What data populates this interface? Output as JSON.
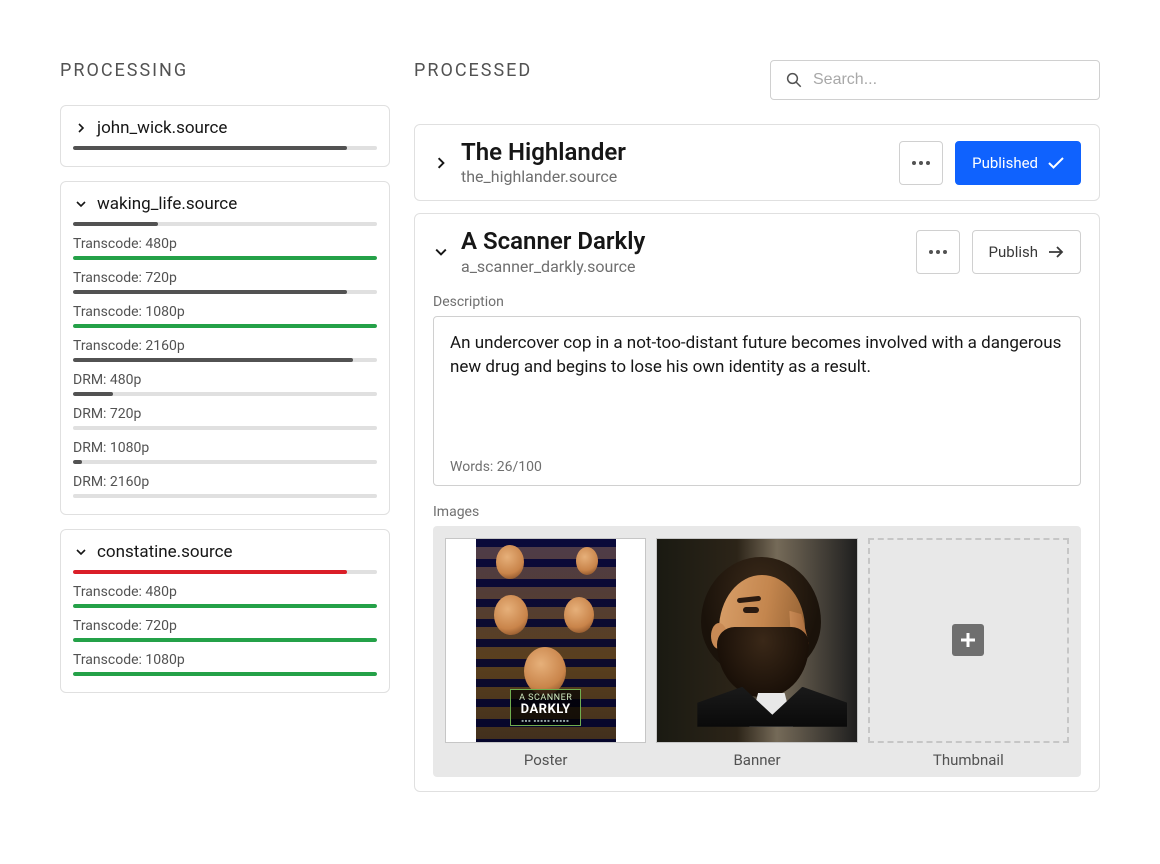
{
  "sections": {
    "processing": "PROCESSING",
    "processed": "PROCESSED"
  },
  "search": {
    "placeholder": "Search..."
  },
  "processing": [
    {
      "title": "john_wick.source",
      "expanded": false,
      "main_progress": 90,
      "main_color": "gray",
      "tasks": []
    },
    {
      "title": "waking_life.source",
      "expanded": true,
      "main_progress": 28,
      "main_color": "gray",
      "tasks": [
        {
          "label": "Transcode: 480p",
          "progress": 100,
          "color": "green"
        },
        {
          "label": "Transcode: 720p",
          "progress": 90,
          "color": "gray"
        },
        {
          "label": "Transcode: 1080p",
          "progress": 100,
          "color": "green"
        },
        {
          "label": "Transcode: 2160p",
          "progress": 92,
          "color": "gray"
        },
        {
          "label": "DRM: 480p",
          "progress": 13,
          "color": "gray"
        },
        {
          "label": "DRM: 720p",
          "progress": 0,
          "color": "gray"
        },
        {
          "label": "DRM: 1080p",
          "progress": 3,
          "color": "gray"
        },
        {
          "label": "DRM: 2160p",
          "progress": 0,
          "color": "gray"
        }
      ]
    },
    {
      "title": "constatine.source",
      "expanded": true,
      "main_progress": 90,
      "main_color": "red",
      "tasks": [
        {
          "label": "Transcode: 480p",
          "progress": 100,
          "color": "green"
        },
        {
          "label": "Transcode: 720p",
          "progress": 100,
          "color": "green"
        },
        {
          "label": "Transcode: 1080p",
          "progress": 100,
          "color": "green"
        }
      ]
    }
  ],
  "processed": [
    {
      "title": "The Highlander",
      "filename": "the_highlander.source",
      "expanded": false,
      "button_label": "Published",
      "button_style": "primary"
    },
    {
      "title": "A Scanner Darkly",
      "filename": "a_scanner_darkly.source",
      "expanded": true,
      "button_label": "Publish",
      "button_style": "outline",
      "description_label": "Description",
      "description": "An undercover cop in a not-too-distant future becomes involved with a dangerous new drug and begins to lose his own identity as a result.",
      "word_count": "Words: 26/100",
      "images_label": "Images",
      "images": {
        "poster_caption": "Poster",
        "banner_caption": "Banner",
        "thumb_caption": "Thumbnail",
        "poster_text_small": "A SCANNER",
        "poster_text_big": "DARKLY"
      }
    }
  ]
}
